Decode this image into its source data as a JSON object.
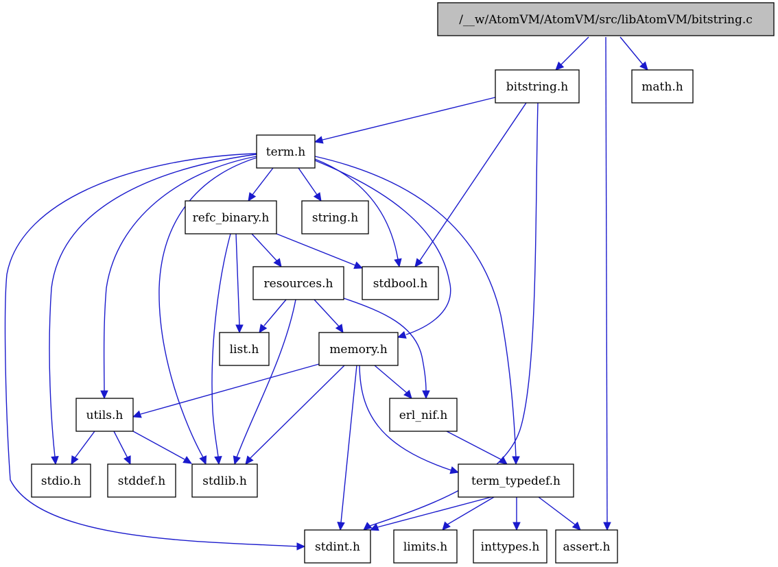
{
  "diagram": {
    "type": "include-dependency-graph",
    "colors": {
      "edge": "#1a1acc",
      "root_fill": "#bfbfbf",
      "node_fill": "#ffffff",
      "node_border": "#000000"
    },
    "nodes": [
      {
        "id": "root",
        "label": "/__w/AtomVM/AtomVM/src/libAtomVM/bitstring.c",
        "root": true
      },
      {
        "id": "bitstring_h",
        "label": "bitstring.h"
      },
      {
        "id": "math_h",
        "label": "math.h"
      },
      {
        "id": "term_h",
        "label": "term.h"
      },
      {
        "id": "refc_binary_h",
        "label": "refc_binary.h"
      },
      {
        "id": "string_h",
        "label": "string.h"
      },
      {
        "id": "resources_h",
        "label": "resources.h"
      },
      {
        "id": "stdbool_h",
        "label": "stdbool.h"
      },
      {
        "id": "list_h",
        "label": "list.h"
      },
      {
        "id": "memory_h",
        "label": "memory.h"
      },
      {
        "id": "utils_h",
        "label": "utils.h"
      },
      {
        "id": "erl_nif_h",
        "label": "erl_nif.h"
      },
      {
        "id": "stdio_h",
        "label": "stdio.h"
      },
      {
        "id": "stddef_h",
        "label": "stddef.h"
      },
      {
        "id": "stdlib_h",
        "label": "stdlib.h"
      },
      {
        "id": "term_typedef_h",
        "label": "term_typedef.h"
      },
      {
        "id": "stdint_h",
        "label": "stdint.h"
      },
      {
        "id": "limits_h",
        "label": "limits.h"
      },
      {
        "id": "inttypes_h",
        "label": "inttypes.h"
      },
      {
        "id": "assert_h",
        "label": "assert.h"
      }
    ],
    "edges": [
      {
        "from": "root",
        "to": "bitstring_h"
      },
      {
        "from": "root",
        "to": "assert_h"
      },
      {
        "from": "root",
        "to": "math_h"
      },
      {
        "from": "bitstring_h",
        "to": "term_h"
      },
      {
        "from": "bitstring_h",
        "to": "stdbool_h"
      },
      {
        "from": "bitstring_h",
        "to": "stdint_h"
      },
      {
        "from": "term_h",
        "to": "refc_binary_h"
      },
      {
        "from": "term_h",
        "to": "string_h"
      },
      {
        "from": "term_h",
        "to": "stdbool_h"
      },
      {
        "from": "term_h",
        "to": "memory_h"
      },
      {
        "from": "term_h",
        "to": "term_typedef_h"
      },
      {
        "from": "term_h",
        "to": "utils_h"
      },
      {
        "from": "term_h",
        "to": "stdio_h"
      },
      {
        "from": "term_h",
        "to": "stdlib_h"
      },
      {
        "from": "term_h",
        "to": "stdint_h"
      },
      {
        "from": "refc_binary_h",
        "to": "resources_h"
      },
      {
        "from": "refc_binary_h",
        "to": "stdbool_h"
      },
      {
        "from": "refc_binary_h",
        "to": "list_h"
      },
      {
        "from": "refc_binary_h",
        "to": "stdlib_h"
      },
      {
        "from": "resources_h",
        "to": "list_h"
      },
      {
        "from": "resources_h",
        "to": "memory_h"
      },
      {
        "from": "resources_h",
        "to": "erl_nif_h"
      },
      {
        "from": "resources_h",
        "to": "stdlib_h"
      },
      {
        "from": "memory_h",
        "to": "utils_h"
      },
      {
        "from": "memory_h",
        "to": "erl_nif_h"
      },
      {
        "from": "memory_h",
        "to": "stdlib_h"
      },
      {
        "from": "memory_h",
        "to": "stdint_h"
      },
      {
        "from": "memory_h",
        "to": "term_typedef_h"
      },
      {
        "from": "utils_h",
        "to": "stdio_h"
      },
      {
        "from": "utils_h",
        "to": "stddef_h"
      },
      {
        "from": "utils_h",
        "to": "stdlib_h"
      },
      {
        "from": "erl_nif_h",
        "to": "term_typedef_h"
      },
      {
        "from": "term_typedef_h",
        "to": "stdint_h"
      },
      {
        "from": "term_typedef_h",
        "to": "limits_h"
      },
      {
        "from": "term_typedef_h",
        "to": "inttypes_h"
      },
      {
        "from": "term_typedef_h",
        "to": "assert_h"
      }
    ]
  }
}
